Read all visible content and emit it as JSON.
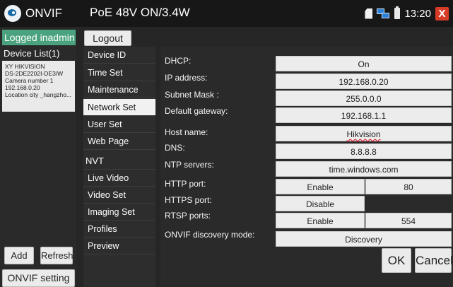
{
  "header": {
    "app_name": "ONVIF",
    "poe_status": "PoE 48V ON/3.4W",
    "clock": "13:20",
    "close_glyph": "X",
    "icons": [
      "onvif-logo-icon",
      "sd-card-icon",
      "network-icon",
      "battery-icon",
      "close-icon"
    ]
  },
  "left_panel": {
    "login_status": "Logged inadmin",
    "device_list_label": "Device List(1)",
    "device": {
      "line1": "XY HIKVISION",
      "line2": "DS-2DE2202I-DE3/W",
      "line3": "Camera number 1",
      "line4": "192.168.0.20",
      "line5": "Location city _hangzho..."
    },
    "add_label": "Add",
    "refresh_label": "Refresh",
    "onvif_setting_label": "ONVIF setting"
  },
  "logout_label": "Logout",
  "menu": {
    "items": [
      {
        "label": "Device ID",
        "active": false
      },
      {
        "label": "Time Set",
        "active": false
      },
      {
        "label": "Maintenance",
        "active": false
      },
      {
        "label": "Network Set",
        "active": true
      },
      {
        "label": "User Set",
        "active": false
      },
      {
        "label": "Web Page",
        "active": false
      }
    ],
    "section_nvt": "NVT",
    "nvt_items": [
      {
        "label": "Live Video"
      },
      {
        "label": "Video Set"
      },
      {
        "label": "Imaging Set"
      },
      {
        "label": "Profiles"
      },
      {
        "label": "Preview"
      }
    ]
  },
  "network": {
    "dhcp_label": "DHCP:",
    "dhcp_value": "On",
    "ip_label": "IP address:",
    "ip_value": "192.168.0.20",
    "subnet_label": "Subnet Mask :",
    "subnet_value": "255.0.0.0",
    "gateway_label": "Default gateway:",
    "gateway_value": "192.168.1.1",
    "host_label": "Host name:",
    "host_value": "Hikvision",
    "dns_label": "DNS:",
    "dns_value": "8.8.8.8",
    "ntp_label": "NTP servers:",
    "ntp_value": "time.windows.com",
    "http_label": "HTTP port:",
    "http_state": "Enable",
    "http_port": "80",
    "https_label": "HTTPS port:",
    "https_state": "Disable",
    "https_port": "",
    "rtsp_label": "RTSP ports:",
    "rtsp_state": "Enable",
    "rtsp_port": "554",
    "discovery_label": "ONVIF discovery mode:",
    "discovery_value": "Discovery"
  },
  "actions": {
    "ok_label": "OK",
    "cancel_label": "Cancel"
  },
  "colors": {
    "login_badge": "#4aa37e",
    "close_button": "#d63b28",
    "active_menu": "#f1f1f1"
  }
}
